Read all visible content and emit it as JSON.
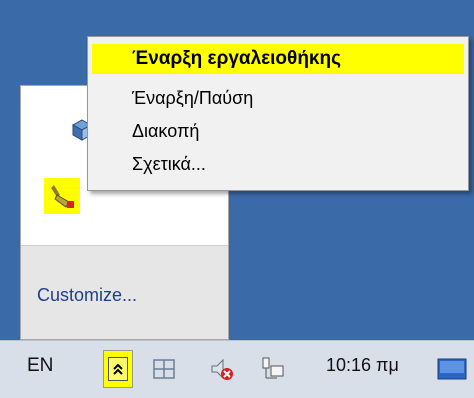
{
  "tray_panel": {
    "customize_label": "Customize...",
    "icons": [
      "virtualbox-icon",
      "toolbox-icon"
    ]
  },
  "context_menu": {
    "items": [
      {
        "label": "Έναρξη εργαλειοθήκης",
        "default": true
      },
      {
        "label": "Έναρξη/Παύση"
      },
      {
        "label": "Διακοπή"
      },
      {
        "label": "Σχετικά..."
      }
    ]
  },
  "taskbar": {
    "language": "EN",
    "overflow_icon": "chevron-up-icon",
    "clock": "10:16 πμ",
    "icons": [
      "windows-grid-icon",
      "speaker-muted-icon",
      "network-icon",
      "show-desktop-icon"
    ]
  },
  "colors": {
    "highlight": "#ffff00",
    "desktop": "#3b6aa9",
    "link": "#1e3f8a"
  }
}
